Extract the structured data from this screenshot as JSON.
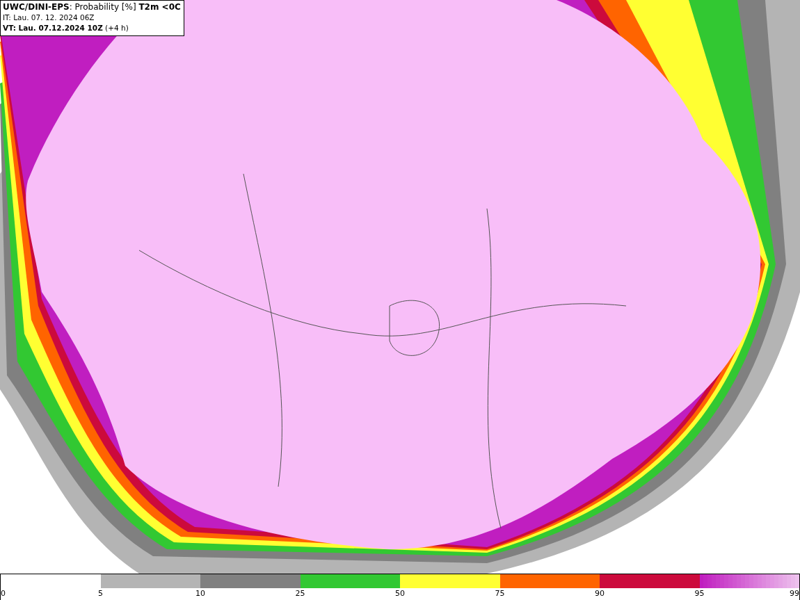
{
  "header": {
    "title": "**UWC/DINI-EPS**: Probability [%] **T2m <0C**",
    "init_time": "IT: Lau. 07. 12. 2024 06Z",
    "valid_time": "**VT: Lau. 07.12.2024 10Z** (+4 h)"
  },
  "legend": {
    "segments": [
      {
        "kind": "blank"
      },
      {
        "kind": "solid",
        "color": "#b4b4b4"
      },
      {
        "kind": "solid",
        "color": "#808080"
      },
      {
        "kind": "solid",
        "color": "#32c832"
      },
      {
        "kind": "solid",
        "color": "#ffff32"
      },
      {
        "kind": "solid",
        "color": "#ff6400"
      },
      {
        "kind": "solid",
        "color": "#cc0a3c"
      },
      {
        "kind": "gradient",
        "color": "#c01ec0"
      }
    ],
    "ticks": [
      "0",
      "5",
      "10",
      "25",
      "50",
      "75",
      "90",
      "95",
      "99"
    ]
  }
}
